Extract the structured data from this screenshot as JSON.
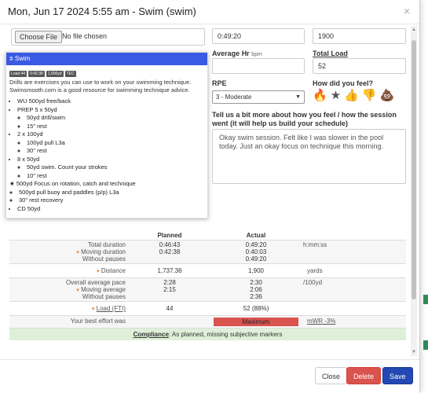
{
  "modal": {
    "title": "Mon, Jun 17 2024 5:55 am - Swim (swim)",
    "close_glyph": "×"
  },
  "file": {
    "button_label": "Choose File",
    "status": "No file chosen"
  },
  "fields": {
    "duration_value": "0:49:20",
    "distance_value": "1900",
    "avg_hr_label": "Average Hr",
    "avg_hr_unit": "bpm",
    "avg_hr_value": "",
    "total_load_label": "Total Load",
    "total_load_value": "52",
    "rpe_label": "RPE",
    "rpe_value": "3 - Moderate",
    "feel_label": "How did you feel?",
    "feel_icons": [
      "fire-icon",
      "star-icon",
      "thumbs-up-icon",
      "thumbs-down-icon",
      "poop-icon"
    ],
    "feedback_label": "Tell us a bit more about how you feel / how the session went (it will help us build your schedule)",
    "feedback_text": "Okay swim session. Felt like I was slower in the pool today. Just an okay focus on technique this morning."
  },
  "workout": {
    "title": "Swim",
    "tags": [
      "Load 44",
      "0:42:38",
      "1,900yd",
      "TEC"
    ],
    "description": "Drills are exercises you can use to work on your swimming technique. Swimsmooth.com is a good resource for swimming technique advice.",
    "items": [
      {
        "text": "WU 500yd free/back",
        "sub": []
      },
      {
        "text": "PREP 5 x 50yd",
        "sub": [
          "50yd drill/swim",
          "15\" rest"
        ]
      },
      {
        "text": "2 x 100yd",
        "sub": [
          "100yd pull L3a",
          "30\" rest"
        ]
      },
      {
        "text": "8 x 50yd",
        "sub": [
          "50yd swim. Count your strokes",
          "10\" rest"
        ]
      },
      {
        "text": "500yd Focus on rotation, catch and technique",
        "sub": [
          "500yd pull buoy and paddles (p/p) L3a",
          "30\" rest recovery"
        ]
      },
      {
        "text": "CD 50yd",
        "sub": []
      }
    ]
  },
  "comparison": {
    "headers": {
      "planned": "Planned",
      "actual": "Actual"
    },
    "duration": {
      "labels": [
        "Total duration",
        "Moving duration",
        "Without pauses"
      ],
      "planned": [
        "0:46:43",
        "0:42:38",
        ""
      ],
      "actual": [
        "0:49:20",
        "0:40:03",
        "0:49:20"
      ],
      "unit": "h:mm:ss"
    },
    "distance": {
      "label": "Distance",
      "planned": "1,737.36",
      "actual": "1,900",
      "unit": "yards"
    },
    "pace": {
      "labels": [
        "Overall average pace",
        "Moving average",
        "Without pauses"
      ],
      "planned": [
        "2:28",
        "2:15",
        ""
      ],
      "actual": [
        "2:30",
        "2:06",
        "2:36"
      ],
      "unit": "/100yd"
    },
    "load": {
      "label": "Load (FTI)",
      "planned": "44",
      "actual": "52 (88%)"
    },
    "best_effort": {
      "label": "Your best effort was",
      "value": "Maximum",
      "unit": "mWR -3%"
    },
    "compliance": {
      "label": "Compliance",
      "text": ": As planned, missing subjective markers"
    }
  },
  "footer": {
    "close": "Close",
    "delete": "Delete",
    "save": "Save"
  },
  "colors": {
    "primary": "#2249b3",
    "danger": "#d9534f",
    "workout_header": "#3a5ae3",
    "compliance_bg": "#dff0d8",
    "accent_orange": "#e67e22"
  }
}
